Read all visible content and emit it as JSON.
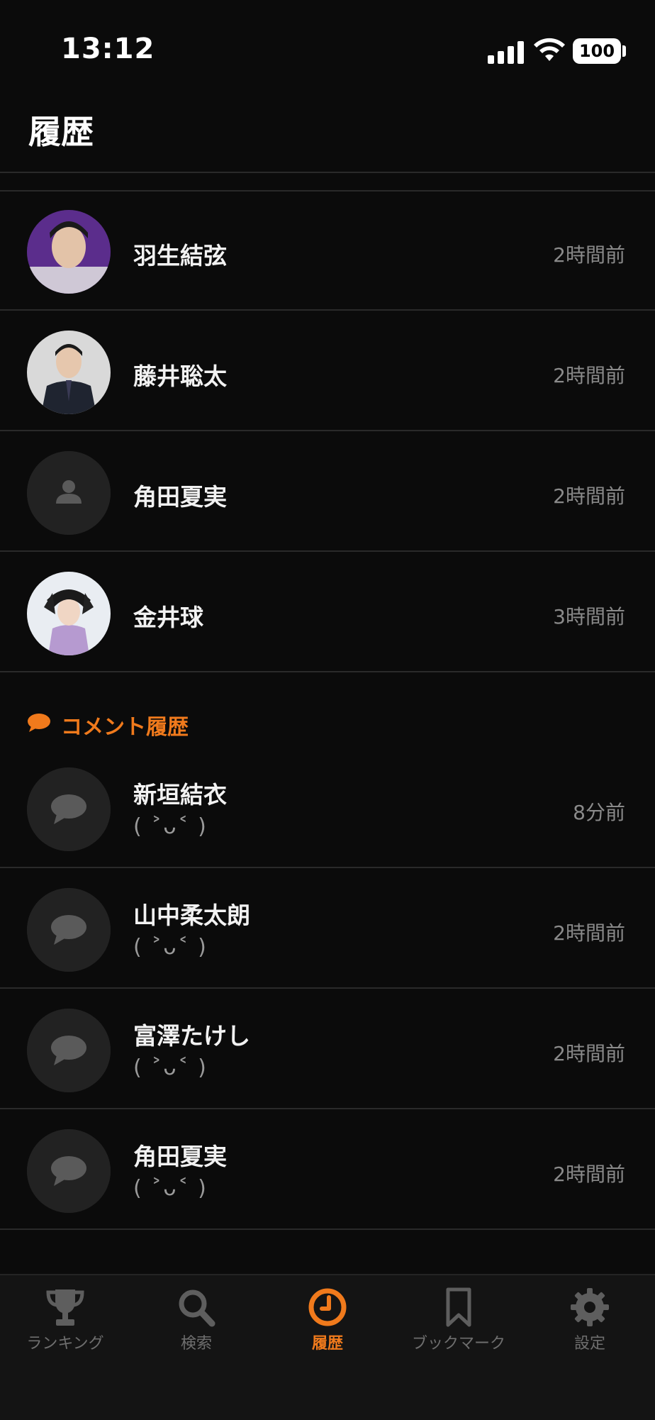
{
  "status": {
    "time": "13:12",
    "battery": "100"
  },
  "header": {
    "title": "履歴"
  },
  "history": [
    {
      "name": "羽生結弦",
      "time": "2時間前",
      "avatar": "photo"
    },
    {
      "name": "藤井聡太",
      "time": "2時間前",
      "avatar": "photo"
    },
    {
      "name": "角田夏実",
      "time": "2時間前",
      "avatar": "placeholder-person-icon"
    },
    {
      "name": "金井球",
      "time": "3時間前",
      "avatar": "photo"
    }
  ],
  "comments_section": {
    "title": "コメント履歴",
    "icon": "speech-bubble-icon"
  },
  "comments": [
    {
      "name": "新垣結衣",
      "text": "( ˃ᴗ˂ )",
      "time": "8分前"
    },
    {
      "name": "山中柔太朗",
      "text": "( ˃ᴗ˂ )",
      "time": "2時間前"
    },
    {
      "name": "富澤たけし",
      "text": "( ˃ᴗ˂ )",
      "time": "2時間前"
    },
    {
      "name": "角田夏実",
      "text": "( ˃ᴗ˂ )",
      "time": "2時間前"
    }
  ],
  "tabs": [
    {
      "label": "ランキング",
      "icon": "trophy-icon"
    },
    {
      "label": "検索",
      "icon": "search-icon"
    },
    {
      "label": "履歴",
      "icon": "clock-icon",
      "active": true
    },
    {
      "label": "ブックマーク",
      "icon": "bookmark-icon"
    },
    {
      "label": "設定",
      "icon": "gear-icon"
    }
  ],
  "colors": {
    "accent": "#f07a1c",
    "background": "#0b0b0b",
    "muted": "#8a8a8a"
  }
}
